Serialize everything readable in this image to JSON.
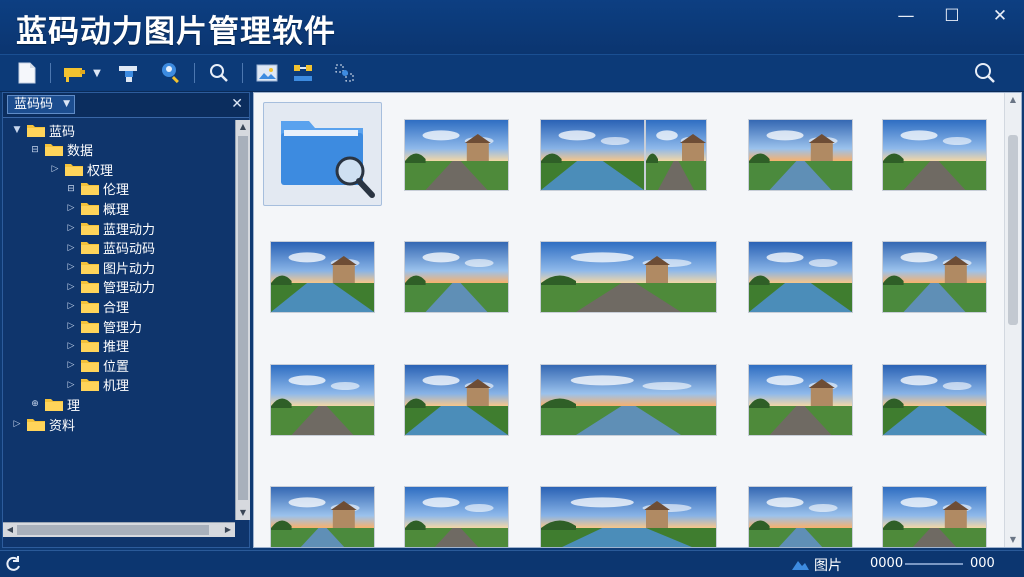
{
  "window": {
    "title": "蓝码动力图片管理软件",
    "controls": {
      "minimize": "—",
      "maximize": "☐",
      "close": "✕"
    }
  },
  "toolbar": {
    "icons": [
      "new-file-icon",
      "camera-icon",
      "filter-icon",
      "person-search-icon",
      "search-icon",
      "image-icon",
      "transfer-icon",
      "settings-icon"
    ],
    "search_icon": "search-icon"
  },
  "sidebar": {
    "dropdown_label": "蓝码码",
    "close": "✕",
    "tree": [
      {
        "label": "蓝码",
        "level": 0,
        "toggle": "▼"
      },
      {
        "label": "数据",
        "level": 1,
        "toggle": "⊟"
      },
      {
        "label": "权理",
        "level": 2,
        "toggle": "▷"
      },
      {
        "label": "伦理",
        "level": 3,
        "toggle": "⊟"
      },
      {
        "label": "概理",
        "level": 3,
        "toggle": "▷"
      },
      {
        "label": "蓝理动力",
        "level": 3,
        "toggle": "▷"
      },
      {
        "label": "蓝码动码",
        "level": 3,
        "toggle": "▷"
      },
      {
        "label": "图片动力",
        "level": 3,
        "toggle": "▷"
      },
      {
        "label": "管理动力",
        "level": 3,
        "toggle": "▷"
      },
      {
        "label": "合理",
        "level": 3,
        "toggle": "▷"
      },
      {
        "label": "管理力",
        "level": 3,
        "toggle": "▷"
      },
      {
        "label": "推理",
        "level": 3,
        "toggle": "▷"
      },
      {
        "label": "位置",
        "level": 3,
        "toggle": "▷"
      },
      {
        "label": "机理",
        "level": 3,
        "toggle": "▷"
      },
      {
        "label": "理",
        "level": 1,
        "toggle": "⊕"
      },
      {
        "label": "资料",
        "level": 0,
        "toggle": "▷"
      }
    ]
  },
  "content": {
    "folder_tile": "folder-search-icon"
  },
  "status": {
    "label": "图片",
    "left_value": "0000",
    "right_value": "000"
  },
  "colors": {
    "window": "#0f3a73",
    "toolbar": "#0c3a78",
    "content_bg": "#f4f6f9",
    "folder": "#3d8be0"
  }
}
